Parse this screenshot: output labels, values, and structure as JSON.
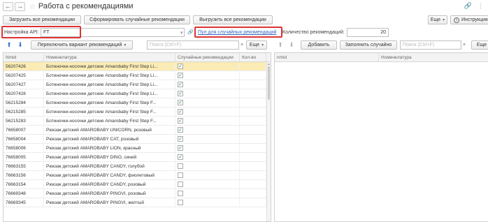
{
  "window": {
    "title": "Работа с рекомендациями"
  },
  "toolbar": {
    "load_all": "Загрузить все рекомендации",
    "generate_random": "Сформировать случайные рекомендации",
    "export_all": "Выгрузить все рекомендации",
    "more": "Еще",
    "instruction": "Инструкция"
  },
  "settings": {
    "api_label": "Настройка API:",
    "api_value": "FT",
    "pool_link": "Пул для случайных рекомендаций",
    "count_label": "Количество рекомендаций:",
    "count_value": "20"
  },
  "left_panel": {
    "switch_variant": "Переключить вариант рекомендаций",
    "search_placeholder": "Поиск (Ctrl+F)",
    "more": "Еще",
    "columns": [
      "Nmid",
      "Номенклатура",
      "Случайные рекомендации",
      "Кол-во"
    ],
    "rows": [
      {
        "nmid": "56207426",
        "name": "Ботиночки-носочки детские Amarobaby First Step Li...",
        "checked": true
      },
      {
        "nmid": "56207425",
        "name": "Ботиночки-носочки детские Amarobaby First Step Li...",
        "checked": true
      },
      {
        "nmid": "56207427",
        "name": "Ботиночки-носочки детские Amarobaby First Step Li...",
        "checked": true
      },
      {
        "nmid": "56207428",
        "name": "Ботиночки-носочки детские Amarobaby First Step Li...",
        "checked": true
      },
      {
        "nmid": "56215284",
        "name": "Ботиночки-носочки детские Amarobaby First Step F...",
        "checked": true
      },
      {
        "nmid": "56215285",
        "name": "Ботиночки-носочки детские Amarobaby First Step F...",
        "checked": true
      },
      {
        "nmid": "56215283",
        "name": "Ботиночки-носочки детские Amarobaby First Step F...",
        "checked": true
      },
      {
        "nmid": "76658007",
        "name": "Рюкзак детский AMAROBABY UNICORN, розовый",
        "checked": true
      },
      {
        "nmid": "76658004",
        "name": "Рюкзак детский AMAROBABY CAT, розовый",
        "checked": true
      },
      {
        "nmid": "76658006",
        "name": "Рюкзак детский AMAROBABY LION, красный",
        "checked": true
      },
      {
        "nmid": "76658005",
        "name": "Рюкзак детский AMAROBABY DINO, синий",
        "checked": true
      },
      {
        "nmid": "76663155",
        "name": "Рюкзак детский AMAROBABY CANDY, голубой",
        "checked": false
      },
      {
        "nmid": "76663156",
        "name": "Рюкзак детский AMAROBABY CANDY, фиолетовый",
        "checked": false
      },
      {
        "nmid": "76663154",
        "name": "Рюкзак детский AMAROBABY CANDY, розовый",
        "checked": false
      },
      {
        "nmid": "76669348",
        "name": "Рюкзак детский AMAROBABY PINGVI, розовый",
        "checked": false
      },
      {
        "nmid": "76669345",
        "name": "Рюкзак детский AMAROBABY PINGVI, желтый",
        "checked": false
      }
    ]
  },
  "right_panel": {
    "add": "Добавить",
    "fill_random": "Заполнить случайно",
    "search_placeholder": "Поиск (Ctrl+F)",
    "more": "Еще",
    "columns": [
      "nmid",
      "Номенклатура"
    ]
  },
  "icons": {
    "back": "arrow-left-icon",
    "forward": "arrow-right-icon",
    "favorite": "star-icon",
    "link": "link-icon",
    "menu": "kebab-icon",
    "info": "info-icon",
    "up": "arrow-up-icon",
    "down": "arrow-down-icon"
  },
  "colors": {
    "selected_row": "#fbecb5",
    "highlight_box": "#dd3333",
    "link": "#3366bb",
    "check": "#2a8a2a"
  }
}
